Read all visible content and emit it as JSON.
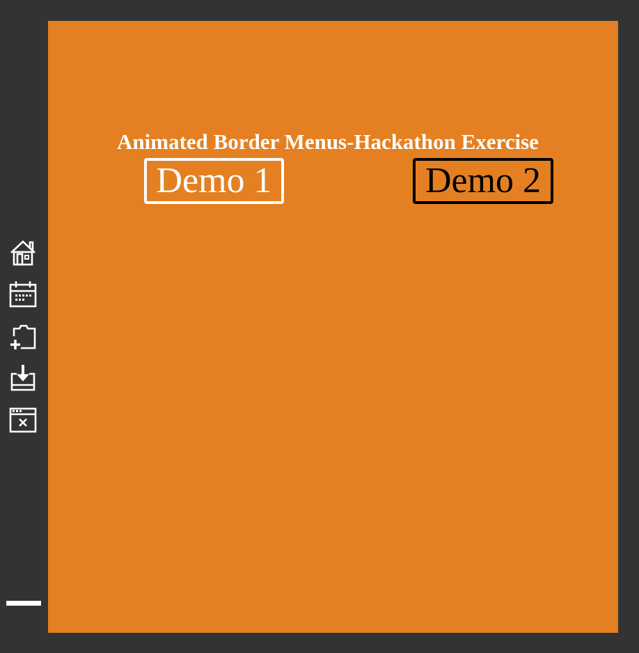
{
  "page": {
    "title": "Animated Border Menus-Hackathon Exercise"
  },
  "menu": {
    "demo1_label": "Demo 1",
    "demo2_label": "Demo 2"
  },
  "sidebar": {
    "icons": [
      "home-icon",
      "calendar-icon",
      "new-folder-icon",
      "download-icon",
      "close-window-icon"
    ]
  },
  "colors": {
    "background": "#333333",
    "stage": "#e48022",
    "demo1_border": "#ffffff",
    "demo2_border": "#000000"
  }
}
